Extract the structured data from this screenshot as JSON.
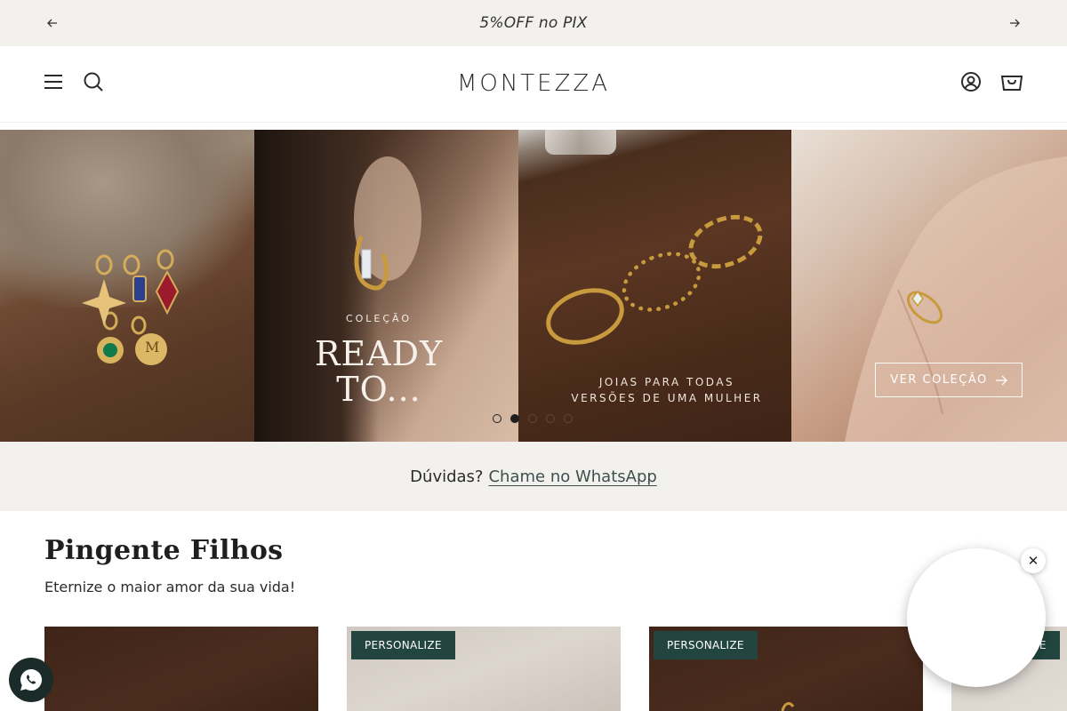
{
  "announcement": {
    "text": "5%OFF no PIX"
  },
  "header": {
    "logo_text": "MONTEZZA"
  },
  "hero": {
    "subtitle": "COLEÇÃO",
    "title_line1": "READY",
    "title_line2": "TO...",
    "tagline_line1": "JOIAS PARA TODAS",
    "tagline_line2": "VERSÕES DE UMA MULHER",
    "charm_letter": "M",
    "cta_label": "VER COLEÇÃO",
    "active_slide": 2,
    "slide_count": 5
  },
  "help": {
    "prefix": "Dúvidas?",
    "link": "Chame no WhatsApp"
  },
  "collection": {
    "title": "Pingente Filhos",
    "subtitle": "Eternize o maior amor da sua vida!",
    "cards": [
      {
        "badge": ""
      },
      {
        "badge": "PERSONALIZE"
      },
      {
        "badge": "PERSONALIZE"
      },
      {
        "badge": "PERSONALIZE"
      }
    ]
  },
  "floating": {
    "close_symbol": "✕"
  },
  "colors": {
    "accent": "#22463f",
    "strip": "#f3f1ee",
    "link": "#3d4f4e"
  },
  "icons": [
    "arrow-left-icon",
    "arrow-right-icon",
    "menu-icon",
    "search-icon",
    "account-icon",
    "cart-icon",
    "whatsapp-icon"
  ]
}
